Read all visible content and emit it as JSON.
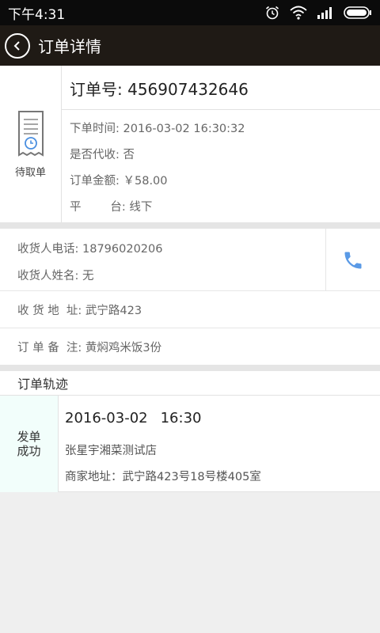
{
  "status_bar": {
    "time": "下午4:31"
  },
  "header": {
    "title": "订单详情"
  },
  "order": {
    "status_label": "待取单",
    "order_no": "订单号: 456907432646",
    "info": [
      "下单时间: 2016-03-02 16:30:32",
      "是否代收: 否",
      "订单金额: ￥58.00",
      "平        台: 线下"
    ]
  },
  "receiver": {
    "phone": "收货人电话: 18796020206",
    "name": "收货人姓名: 无",
    "address": "收 货 地  址: 武宁路423",
    "note": "订 单 备  注: 黄焖鸡米饭3份"
  },
  "track": {
    "header": "订单轨迹",
    "items": [
      {
        "status": "发单成功",
        "date": "2016-03-02",
        "time": "16:30",
        "store": "张星宇湘菜测试店",
        "address": "商家地址：武宁路423号18号楼405室"
      }
    ]
  },
  "colors": {
    "titlebar": "#1f1a15",
    "phone_icon": "#5a9ae6",
    "track_status_bg": "#f2fefb"
  }
}
